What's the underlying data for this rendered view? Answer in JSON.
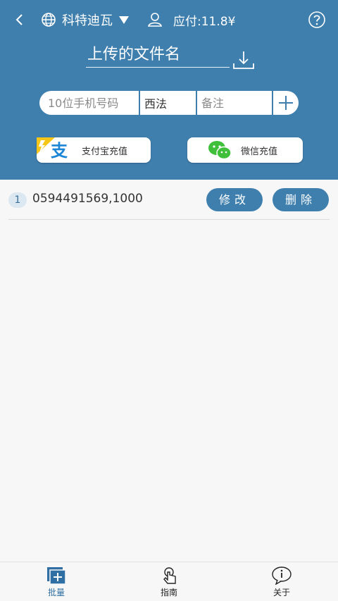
{
  "header": {
    "region": "科特迪瓦",
    "payable": "应付:11.8¥",
    "filename": "上传的文件名"
  },
  "inputs": {
    "phone_placeholder": "10位手机号码",
    "name_value": "西法",
    "note_placeholder": "备注"
  },
  "pay": {
    "alipay_label": "支付宝充值",
    "wechat_label": "微信充值"
  },
  "list": [
    {
      "index": "1",
      "text": "0594491569,1000",
      "edit": "修改",
      "delete": "删除"
    }
  ],
  "tabs": [
    {
      "label": "批量"
    },
    {
      "label": "指南"
    },
    {
      "label": "关于"
    }
  ],
  "colors": {
    "primary": "#3f7fae",
    "active_tab": "#2f6fa3"
  }
}
